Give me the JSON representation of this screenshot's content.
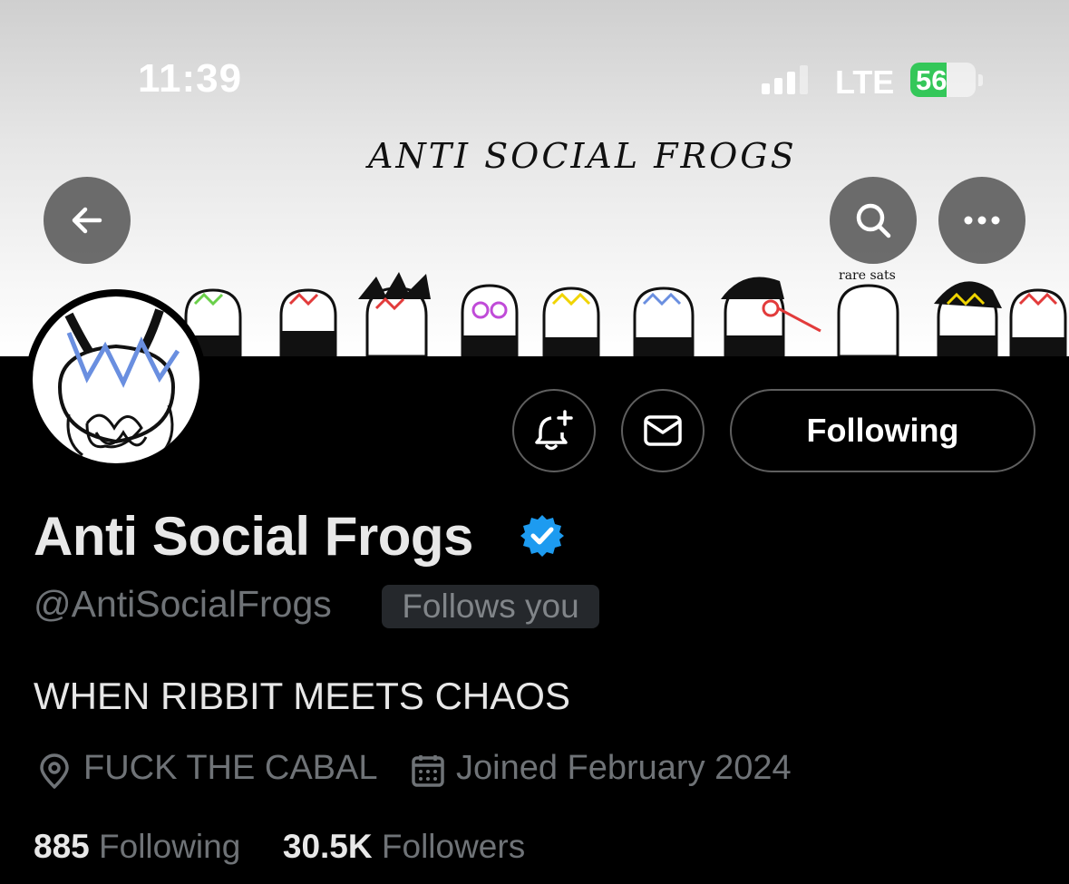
{
  "status_bar": {
    "time": "11:39",
    "network": "LTE",
    "battery_level": "56",
    "battery_percent": 56,
    "signal_bars": 3,
    "signal_bars_total": 4
  },
  "banner": {
    "title": "ANTI SOCIAL FROGS",
    "caption": "rare sats"
  },
  "nav": {
    "back_icon": "arrow-left-icon",
    "search_icon": "search-icon",
    "more_icon": "more-horizontal-icon"
  },
  "actions": {
    "notify_icon": "bell-plus-icon",
    "message_icon": "envelope-icon",
    "follow_label": "Following"
  },
  "profile": {
    "display_name": "Anti Social Frogs",
    "handle": "@AntiSocialFrogs",
    "follows_you": "Follows you",
    "bio": "WHEN RIBBIT MEETS CHAOS",
    "location": "FUCK THE CABAL",
    "joined": "Joined February 2024",
    "following_count": "885",
    "following_label": "Following",
    "followers_count": "30.5K",
    "followers_label": "Followers"
  },
  "colors": {
    "background": "#000000",
    "verified": "#1d9bf0",
    "battery": "#34c759",
    "muted_text": "#6f7377"
  }
}
